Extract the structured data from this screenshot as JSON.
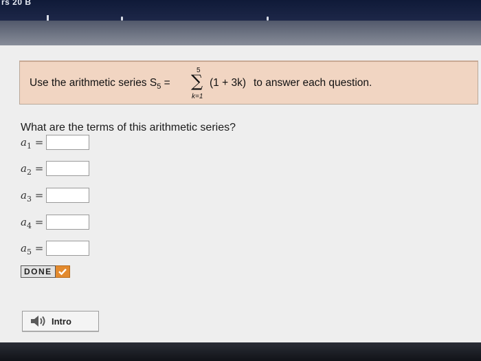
{
  "header": {
    "partial_text": "rs 20 B"
  },
  "prompt": {
    "lead": "Use the arithmetic series S",
    "lead_sub": "5",
    "equals": " =",
    "sigma_upper": "5",
    "sigma_symbol": "∑",
    "sigma_lower": "k=1",
    "expression": "(1 + 3k)",
    "tail": "to answer each question."
  },
  "question": "What are the terms of this arithmetic series?",
  "terms": [
    {
      "var": "a",
      "sub": "1",
      "eq": " =",
      "value": ""
    },
    {
      "var": "a",
      "sub": "2",
      "eq": " =",
      "value": ""
    },
    {
      "var": "a",
      "sub": "3",
      "eq": " =",
      "value": ""
    },
    {
      "var": "a",
      "sub": "4",
      "eq": " =",
      "value": ""
    },
    {
      "var": "a",
      "sub": "5",
      "eq": " =",
      "value": ""
    }
  ],
  "done_button": {
    "label": "DONE",
    "icon": "checkmark-icon"
  },
  "intro_button": {
    "label": "Intro",
    "icon": "speaker-icon"
  },
  "colors": {
    "prompt_bg": "#f1d5c2",
    "done_check": "#e38a2e",
    "panel_bg": "#eeeeee"
  }
}
